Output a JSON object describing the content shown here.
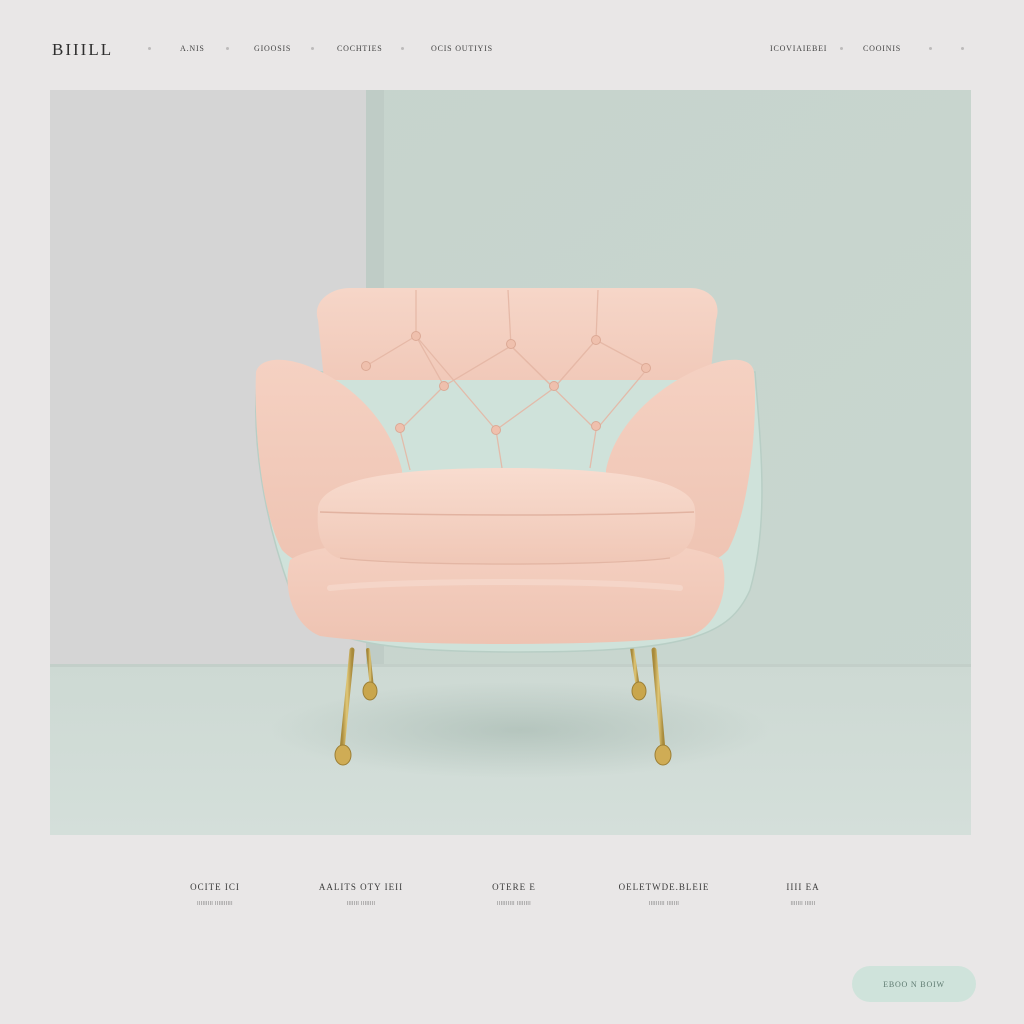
{
  "brand": {
    "logo": "BIIILL"
  },
  "nav": {
    "left_links": [
      {
        "label": "A.NIS"
      },
      {
        "label": "GIOOSIS"
      },
      {
        "label": "COCHTIES"
      },
      {
        "label": "OCIS OUTIYIS"
      }
    ],
    "right_links": [
      {
        "label": "ICOVIAIEBEI"
      },
      {
        "label": "COOINIS"
      }
    ]
  },
  "hero": {
    "product": "tufted-armchair",
    "colors": {
      "left_wall": "#d3d3d3",
      "right_wall": "#c8d6cf",
      "floor": "#d0dbd6",
      "upholstery": "#f4cfc0",
      "trim": "#cfe2da",
      "legs": "#c9a64c"
    }
  },
  "features": [
    {
      "title": "OCITE ICI",
      "subtitle": "IIIIIIIII IIIIIIIIII"
    },
    {
      "title": "AALITS OTY IEII",
      "subtitle": "IIIIIII IIIIIIII"
    },
    {
      "title": "OTERE E",
      "subtitle": "IIIIIIIIII IIIIIIII"
    },
    {
      "title": "OELETWDE.BLEIE",
      "subtitle": "IIIIIIIII IIIIIII"
    },
    {
      "title": "IIII EA",
      "subtitle": "IIIIIII IIIIII"
    }
  ],
  "cta": {
    "label": "EBOO N BOIW"
  }
}
